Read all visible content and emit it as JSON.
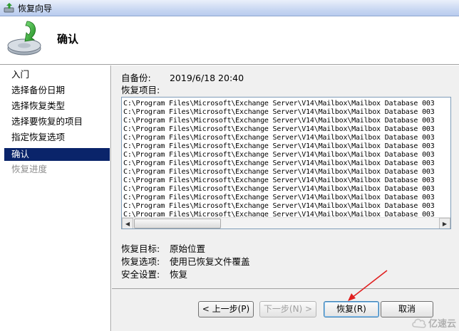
{
  "window": {
    "title": "恢复向导"
  },
  "header": {
    "title": "确认"
  },
  "sidebar": {
    "steps": [
      {
        "label": "入门",
        "state": "normal"
      },
      {
        "label": "选择备份日期",
        "state": "normal"
      },
      {
        "label": "选择恢复类型",
        "state": "normal"
      },
      {
        "label": "选择要恢复的项目",
        "state": "normal"
      },
      {
        "label": "指定恢复选项",
        "state": "normal"
      },
      {
        "label": "确认",
        "state": "active"
      },
      {
        "label": "恢复进度",
        "state": "disabled"
      }
    ]
  },
  "main": {
    "backup_from_label": "自备份:",
    "backup_from_value": "2019/6/18 20:40",
    "items_label": "恢复项目:",
    "items": [
      "C:\\Program Files\\Microsoft\\Exchange Server\\V14\\Mailbox\\Mailbox Database 003",
      "C:\\Program Files\\Microsoft\\Exchange Server\\V14\\Mailbox\\Mailbox Database 003",
      "C:\\Program Files\\Microsoft\\Exchange Server\\V14\\Mailbox\\Mailbox Database 003",
      "C:\\Program Files\\Microsoft\\Exchange Server\\V14\\Mailbox\\Mailbox Database 003",
      "C:\\Program Files\\Microsoft\\Exchange Server\\V14\\Mailbox\\Mailbox Database 003",
      "C:\\Program Files\\Microsoft\\Exchange Server\\V14\\Mailbox\\Mailbox Database 003",
      "C:\\Program Files\\Microsoft\\Exchange Server\\V14\\Mailbox\\Mailbox Database 003",
      "C:\\Program Files\\Microsoft\\Exchange Server\\V14\\Mailbox\\Mailbox Database 003",
      "C:\\Program Files\\Microsoft\\Exchange Server\\V14\\Mailbox\\Mailbox Database 003",
      "C:\\Program Files\\Microsoft\\Exchange Server\\V14\\Mailbox\\Mailbox Database 003",
      "C:\\Program Files\\Microsoft\\Exchange Server\\V14\\Mailbox\\Mailbox Database 003",
      "C:\\Program Files\\Microsoft\\Exchange Server\\V14\\Mailbox\\Mailbox Database 003",
      "C:\\Program Files\\Microsoft\\Exchange Server\\V14\\Mailbox\\Mailbox Database 003",
      "C:\\Program Files\\Microsoft\\Exchange Server\\V14\\Mailbox\\Mailbox Database 003"
    ],
    "target_label": "恢复目标:",
    "target_value": "原始位置",
    "options_label": "恢复选项:",
    "options_value": "使用已恢复文件覆盖",
    "security_label": "安全设置:",
    "security_value": "恢复"
  },
  "buttons": {
    "back": "< 上一步(P)",
    "next": "下一步(N) >",
    "recover": "恢复(R)",
    "cancel": "取消"
  },
  "watermark": {
    "text": "亿速云"
  },
  "colors": {
    "selection": "#0a246a",
    "annotation_arrow": "#e02020",
    "panel": "#f0f0f0"
  }
}
